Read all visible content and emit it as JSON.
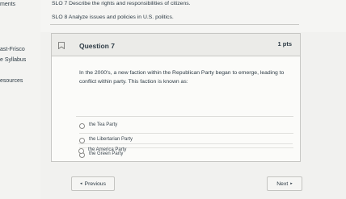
{
  "nav": {
    "items": [
      {
        "label": "ments"
      },
      {
        "label": "ast-Frisco"
      },
      {
        "label": "e Syllabus"
      },
      {
        "label": "esources"
      }
    ]
  },
  "header": {
    "slo_7": "SLO 7 Describe the rights and responsibilities of citizens.",
    "slo_8": "SLO 8 Analyze issues and policies in U.S. politics."
  },
  "question": {
    "title": "Question 7",
    "points": "1 pts",
    "text": "In the 2000's, a new faction within the Republican Party began to emerge, leading to conflict within party. This faction is known as:",
    "flag_icon": "bookmark-flag-icon",
    "answers": [
      {
        "label": "the Tea Party"
      },
      {
        "label": "the Libertarian Party"
      },
      {
        "label": "the Green Party"
      },
      {
        "label": "the America Party"
      }
    ]
  },
  "footer": {
    "prev_label": "Previous",
    "next_label": "Next",
    "prev_arrow": "◂",
    "next_arrow": "▸"
  }
}
